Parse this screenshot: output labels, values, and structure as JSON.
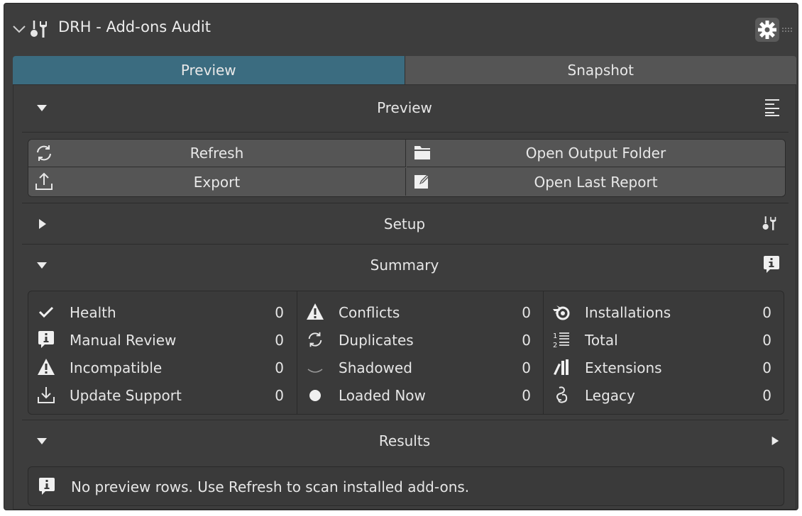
{
  "header": {
    "title": "DRH - Add-ons Audit"
  },
  "tabs": [
    {
      "label": "Preview",
      "active": true
    },
    {
      "label": "Snapshot",
      "active": false
    }
  ],
  "preview_section": {
    "title": "Preview"
  },
  "actions": {
    "refresh": "Refresh",
    "open_output_folder": "Open Output Folder",
    "export": "Export",
    "open_last_report": "Open Last Report"
  },
  "setup_section": {
    "title": "Setup"
  },
  "summary_section": {
    "title": "Summary",
    "col1": [
      {
        "icon": "checkmark-icon",
        "label": "Health",
        "value": "0"
      },
      {
        "icon": "info-icon",
        "label": "Manual Review",
        "value": "0"
      },
      {
        "icon": "warning-icon",
        "label": "Incompatible",
        "value": "0"
      },
      {
        "icon": "download-icon",
        "label": "Update Support",
        "value": "0"
      }
    ],
    "col2": [
      {
        "icon": "warning-icon",
        "label": "Conflicts",
        "value": "0"
      },
      {
        "icon": "refresh-icon",
        "label": "Duplicates",
        "value": "0"
      },
      {
        "icon": "shadow-icon",
        "label": "Shadowed",
        "value": "0"
      },
      {
        "icon": "dot-icon",
        "label": "Loaded Now",
        "value": "0"
      }
    ],
    "col3": [
      {
        "icon": "blender-icon",
        "label": "Installations",
        "value": "0"
      },
      {
        "icon": "numbered-list-icon",
        "label": "Total",
        "value": "0"
      },
      {
        "icon": "library-icon",
        "label": "Extensions",
        "value": "0"
      },
      {
        "icon": "script-icon",
        "label": "Legacy",
        "value": "0"
      }
    ]
  },
  "results_section": {
    "title": "Results",
    "message": "No preview rows. Use Refresh to scan installed add-ons."
  },
  "colors": {
    "active_tab": "#3b6c80",
    "panel_bg": "#3d3d3d",
    "button_bg": "#555555"
  }
}
